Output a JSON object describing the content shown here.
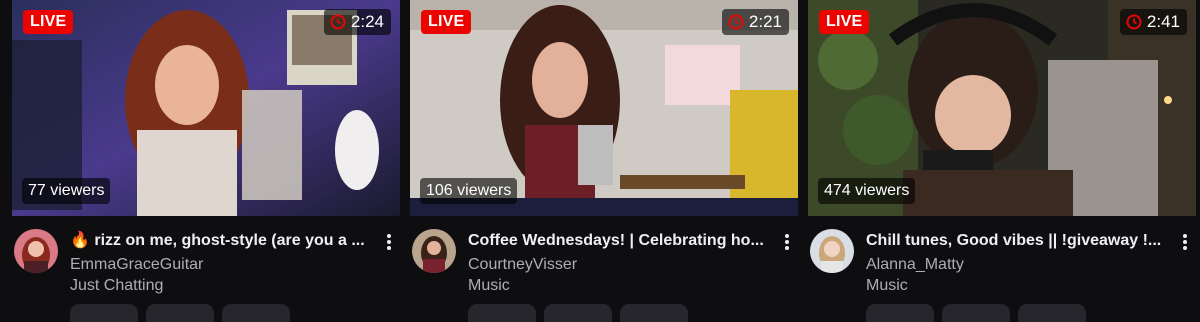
{
  "cards": [
    {
      "live_label": "LIVE",
      "uptime": "2:24",
      "viewers": "77 viewers",
      "title": "🔥 rizz on me, ghost-style (are you a ...",
      "channel": "EmmaGraceGuitar",
      "category": "Just Chatting"
    },
    {
      "live_label": "LIVE",
      "uptime": "2:21",
      "viewers": "106 viewers",
      "title": "Coffee Wednesdays! | Celebrating ho...",
      "channel": "CourtneyVisser",
      "category": "Music"
    },
    {
      "live_label": "LIVE",
      "uptime": "2:41",
      "viewers": "474 viewers",
      "title": "Chill tunes, Good vibes || !giveaway !...",
      "channel": "Alanna_Matty",
      "category": "Music"
    }
  ],
  "icons": {
    "uptime": "clock-icon",
    "more": "more-vertical-icon"
  },
  "colors": {
    "background": "#0e0e10",
    "live_badge": "#eb0400",
    "secondary_text": "#adadb8"
  }
}
